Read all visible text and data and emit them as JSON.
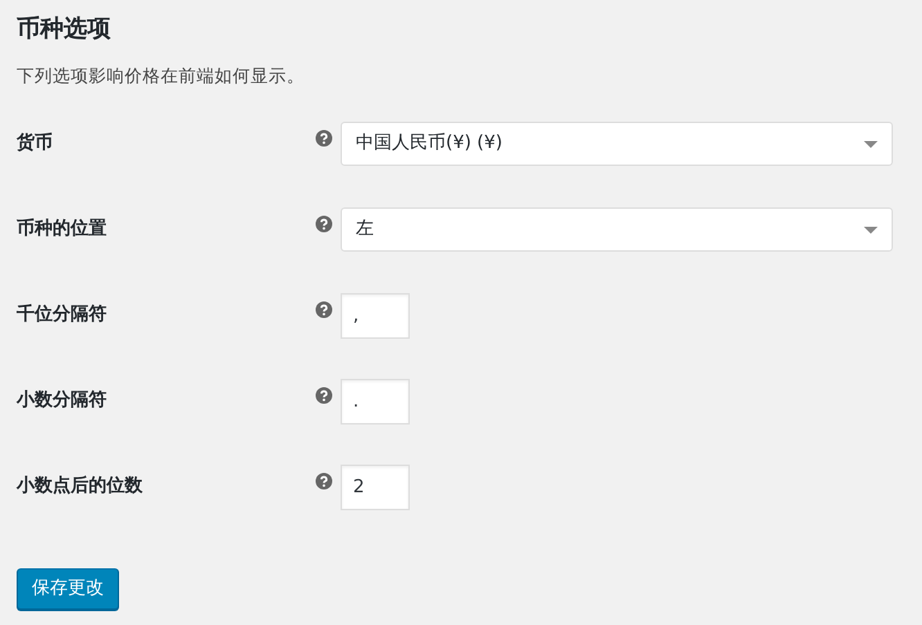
{
  "title": "币种选项",
  "description": "下列选项影响价格在前端如何显示。",
  "fields": [
    {
      "label": "货币",
      "kind": "select",
      "value": "中国人民币(¥) (¥)"
    },
    {
      "label": "币种的位置",
      "kind": "select",
      "value": "左"
    },
    {
      "label": "千位分隔符",
      "kind": "text",
      "value": ","
    },
    {
      "label": "小数分隔符",
      "kind": "text",
      "value": "."
    },
    {
      "label": "小数点后的位数",
      "kind": "text",
      "value": "2"
    }
  ],
  "save_button": "保存更改"
}
